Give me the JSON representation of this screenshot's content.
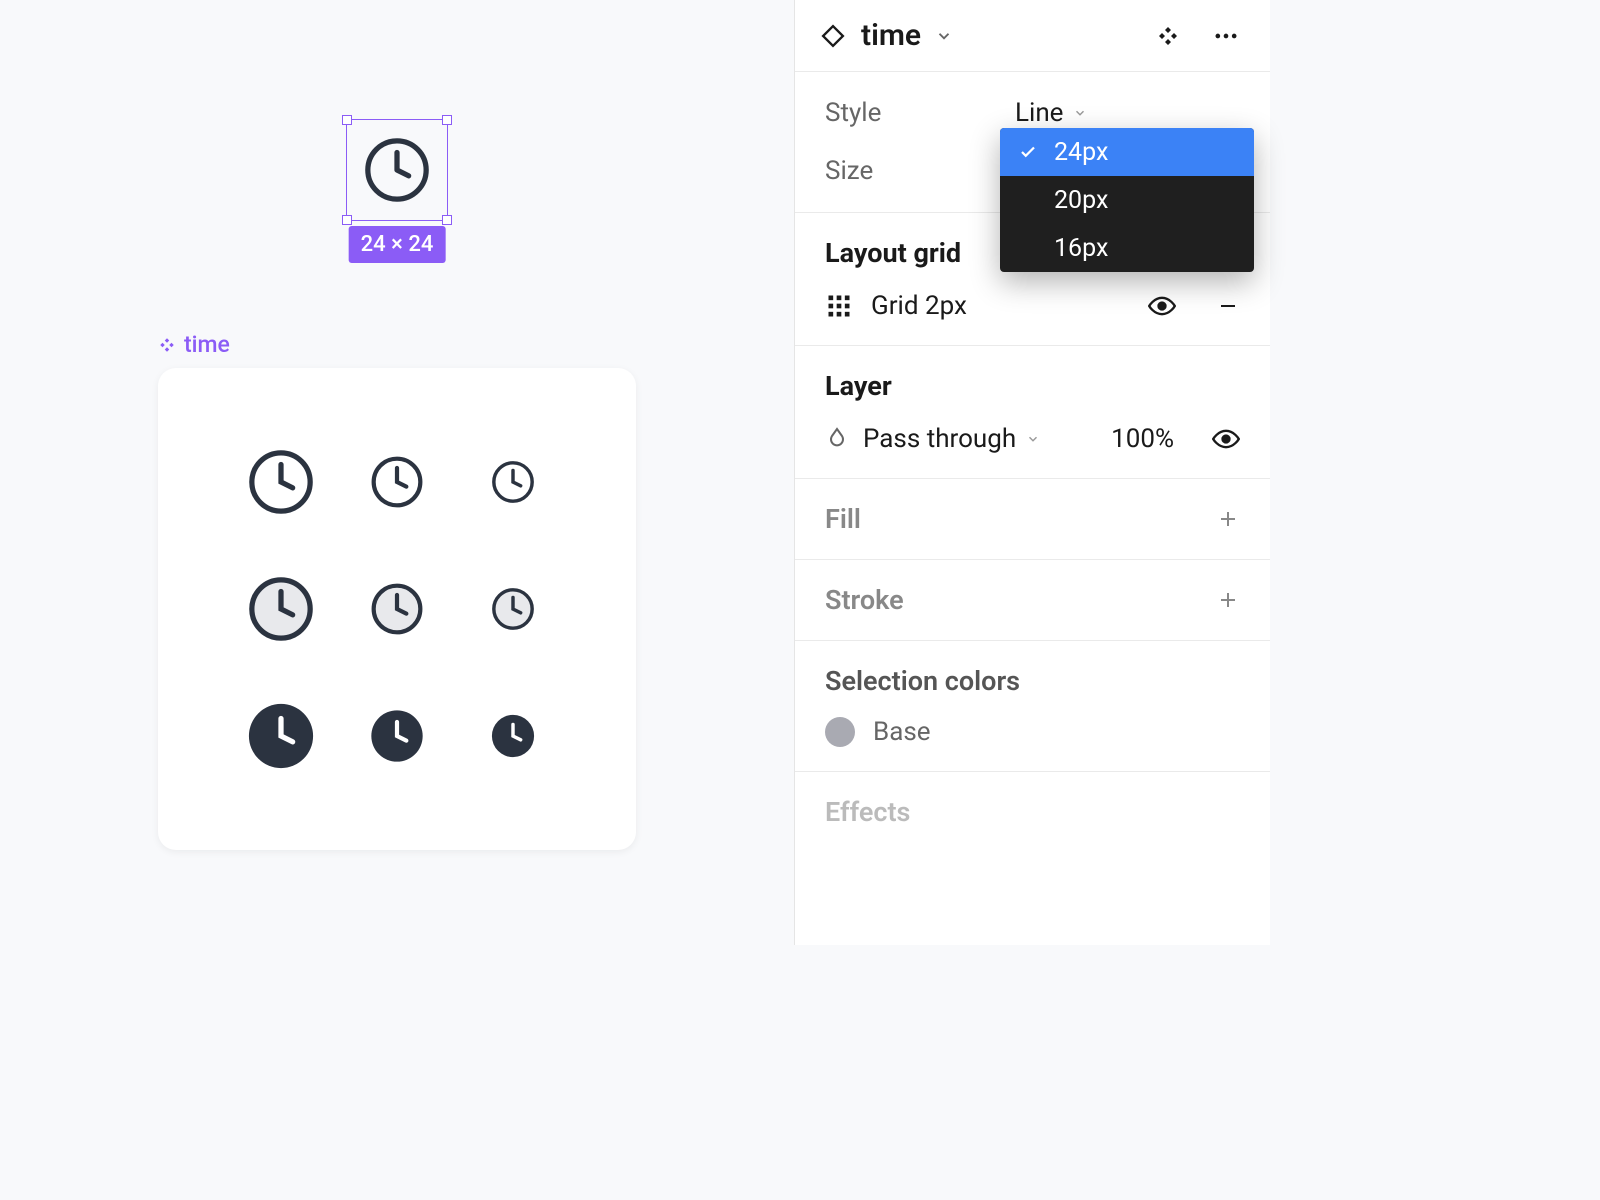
{
  "component": {
    "name": "time",
    "size_badge": "24 × 24"
  },
  "variant_label": "time",
  "panel": {
    "header_title": "time",
    "style_label": "Style",
    "style_value": "Line",
    "size_label": "Size",
    "size_options": [
      "24px",
      "20px",
      "16px"
    ],
    "selected_size": "24px",
    "layout_grid_title": "Layout grid",
    "grid_value": "Grid 2px",
    "layer_title": "Layer",
    "layer_blend": "Pass through",
    "layer_opacity": "100%",
    "fill_title": "Fill",
    "stroke_title": "Stroke",
    "selection_colors_title": "Selection colors",
    "selection_color_name": "Base",
    "effects_title": "Effects"
  }
}
